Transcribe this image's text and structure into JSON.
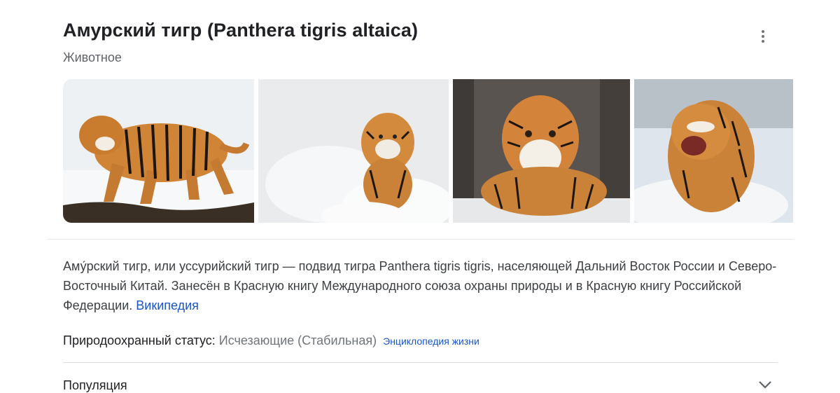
{
  "header": {
    "title": "Амурский тигр (Panthera tigris altaica)",
    "subtitle": "Животное"
  },
  "images": [
    {
      "alt": "tiger-walking-in-snow"
    },
    {
      "alt": "tiger-running-in-snow"
    },
    {
      "alt": "tiger-portrait-lying"
    },
    {
      "alt": "tiger-snarling-in-snow"
    }
  ],
  "description": {
    "text": "Аму́рский тигр, или уссурийский тигр — подвид тигра Panthera tigris tigris, населяющей Дальний Восток России и Северо-Восточный Китай. Занесён в Красную книгу Международного союза охраны природы и в Красную книгу Российской Федерации. ",
    "source_link": "Википедия"
  },
  "status": {
    "label": "Природоохранный статус:",
    "value": "Исчезающие (Стабильная)",
    "source": "Энциклопедия жизни"
  },
  "sections": {
    "population": "Популяция"
  },
  "colors": {
    "link": "#1a55c7",
    "muted": "#70757a"
  },
  "icons": {
    "more": "more-vert-icon",
    "expand": "chevron-down-icon"
  }
}
